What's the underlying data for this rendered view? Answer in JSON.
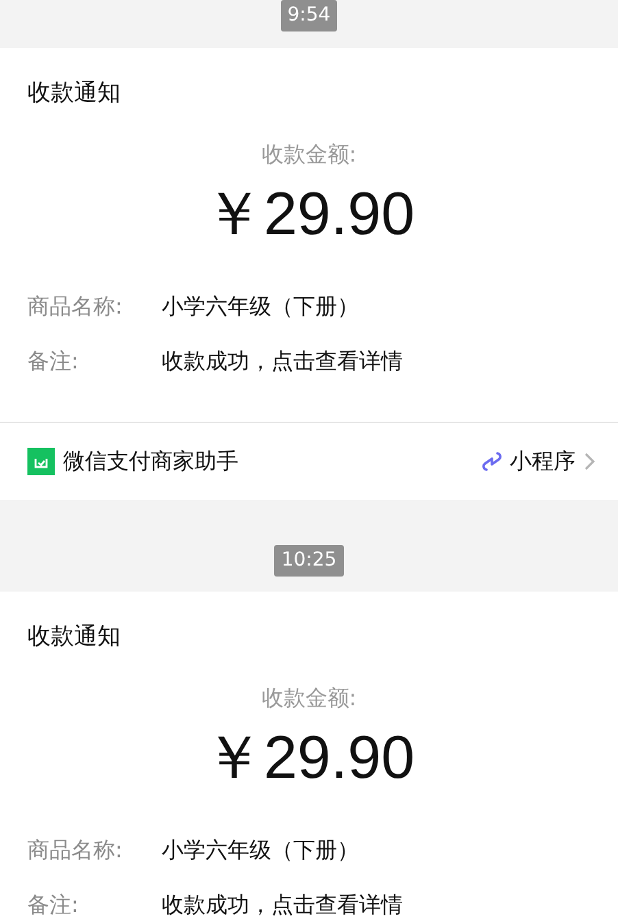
{
  "messages": [
    {
      "time": "9:54",
      "card": {
        "title": "收款通知",
        "amount_label": "收款金额:",
        "amount": "￥29.90",
        "fields": [
          {
            "label": "商品名称:",
            "value": "小学六年级（下册）"
          },
          {
            "label": "备注:",
            "value": "收款成功，点击查看详情"
          }
        ],
        "footer": {
          "source": "微信支付商家助手",
          "link": "小程序"
        }
      }
    },
    {
      "time": "10:25",
      "card": {
        "title": "收款通知",
        "amount_label": "收款金额:",
        "amount": "￥29.90",
        "fields": [
          {
            "label": "商品名称:",
            "value": "小学六年级（下册）"
          },
          {
            "label": "备注:",
            "value": "收款成功，点击查看详情"
          }
        ]
      }
    }
  ]
}
